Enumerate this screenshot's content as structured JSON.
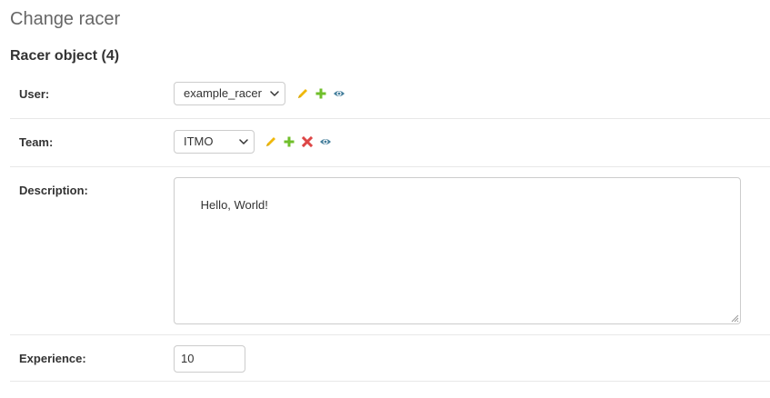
{
  "page": {
    "title": "Change racer"
  },
  "fieldset": {
    "title": "Racer object (4)"
  },
  "fields": {
    "user": {
      "label": "User:",
      "selected": "example_racer",
      "actions": [
        "pencil-icon",
        "plus-icon",
        "eye-icon"
      ]
    },
    "team": {
      "label": "Team:",
      "selected": "ITMO",
      "actions": [
        "pencil-icon",
        "plus-icon",
        "cross-icon",
        "eye-icon"
      ]
    },
    "description": {
      "label": "Description:",
      "value": "Hello, World!"
    },
    "experience": {
      "label": "Experience:",
      "value": "10"
    }
  },
  "colors": {
    "change_icon": "#efb80b",
    "add_icon": "#70bf2b",
    "delete_icon": "#dd4646",
    "view_icon": "#447e9b",
    "border": "#cccccc",
    "row_separator": "#e8e8e8"
  }
}
